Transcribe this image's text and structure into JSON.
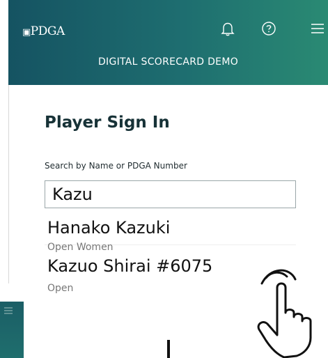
{
  "header": {
    "logo_text": "PDGA",
    "subtitle": "DIGITAL SCORECARD DEMO",
    "icons": [
      "bell-icon",
      "help-icon",
      "menu-icon"
    ],
    "gradient_colors": [
      "#155362",
      "#2a8a73"
    ]
  },
  "signin": {
    "title": "Player Sign In",
    "search_label": "Search by Name or PDGA Number",
    "search_value": "Kazu"
  },
  "results": [
    {
      "name": "Hanako Kazuki",
      "division": "Open Women"
    },
    {
      "name": "Kazuo Shirai #6075",
      "division": "Open"
    }
  ],
  "overlay": {
    "pointer": "hand-pointer-icon"
  }
}
